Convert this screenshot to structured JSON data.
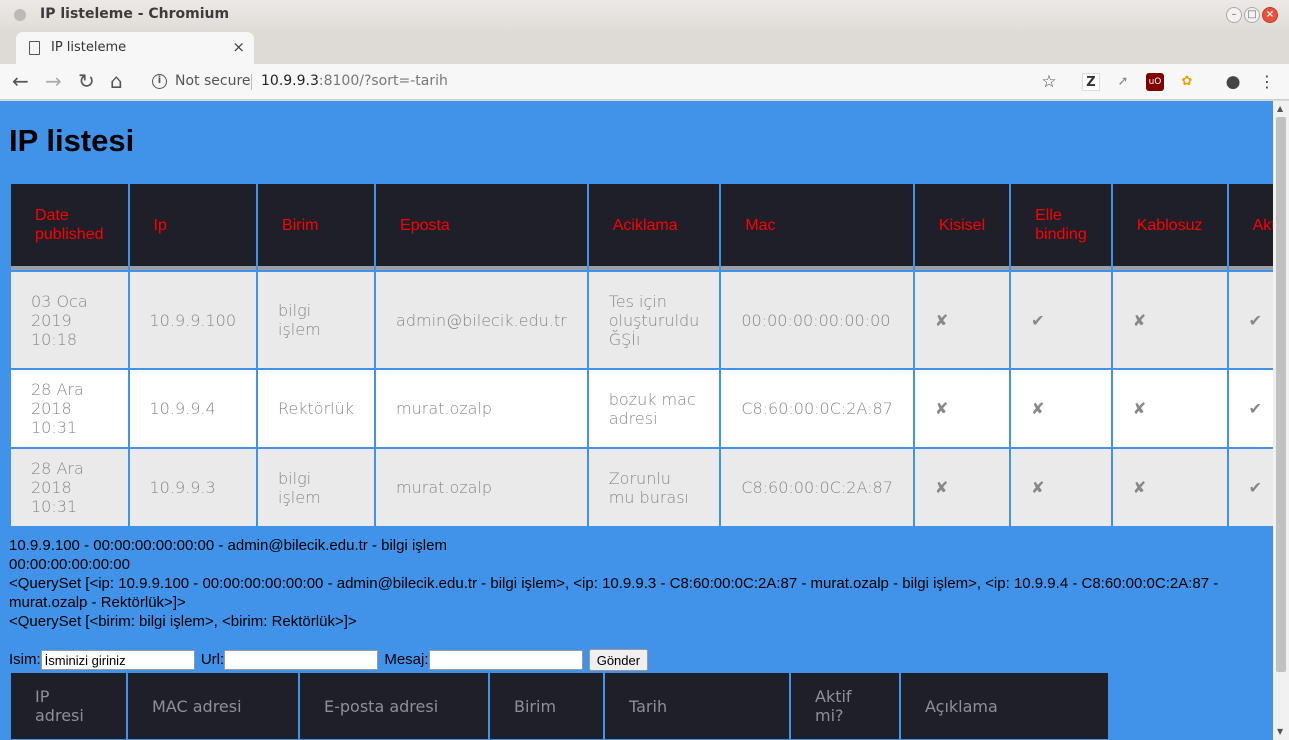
{
  "window": {
    "title": "IP listeleme - Chromium"
  },
  "tab": {
    "title": "IP listeleme",
    "close": "×",
    "new_tab": "+"
  },
  "omnibox": {
    "security": "Not secure",
    "host": "10.9.9.3",
    "path": ":8100/?sort=-tarih"
  },
  "page": {
    "title": "IP listesi",
    "columns": [
      "Date published",
      "Ip",
      "Birim",
      "Eposta",
      "Aciklama",
      "Mac",
      "Kisisel",
      "Elle binding",
      "Kablosuz",
      "Aktif"
    ],
    "rows": [
      {
        "date": "03 Oca 2019 10:18",
        "ip": "10.9.9.100",
        "birim": "bilgi işlem",
        "eposta": "admin@bilecik.edu.tr",
        "aciklama": "Tes için oluşturuldu ĞŞİı",
        "mac": "00:00:00:00:00:00",
        "kisisel": "✘",
        "elle": "✔",
        "kablosuz": "✘",
        "aktif": "✔"
      },
      {
        "date": "28 Ara 2018 10:31",
        "ip": "10.9.9.4",
        "birim": "Rektörlük",
        "eposta": "murat.ozalp",
        "aciklama": "bozuk mac adresi",
        "mac": "C8:60:00:0C:2A:87",
        "kisisel": "✘",
        "elle": "✘",
        "kablosuz": "✘",
        "aktif": "✔"
      },
      {
        "date": "28 Ara 2018 10:31",
        "ip": "10.9.9.3",
        "birim": "bilgi işlem",
        "eposta": "murat.ozalp",
        "aciklama": "Zorunlu mu burası",
        "mac": "C8:60:00:0C:2A:87",
        "kisisel": "✘",
        "elle": "✘",
        "kablosuz": "✘",
        "aktif": "✔"
      }
    ],
    "debug": {
      "line1": "10.9.9.100 - 00:00:00:00:00:00 - admin@bilecik.edu.tr - bilgi işlem",
      "line2": "00:00:00:00:00:00",
      "line3": "<QuerySet [<ip: 10.9.9.100 - 00:00:00:00:00:00 - admin@bilecik.edu.tr - bilgi işlem>, <ip: 10.9.9.3 - C8:60:00:0C:2A:87 - murat.ozalp - bilgi işlem>, <ip: 10.9.9.4 - C8:60:00:0C:2A:87 - murat.ozalp - Rektörlük>]>",
      "line4": "<QuerySet [<birim: bilgi işlem>, <birim: Rektörlük>]>"
    },
    "form": {
      "isim_label": "Isim:",
      "isim_value": "İsminizi giriniz",
      "url_label": "Url:",
      "url_value": "",
      "mesaj_label": "Mesaj:",
      "mesaj_value": "",
      "submit": "Gönder"
    },
    "bottom_columns": [
      "IP adresi",
      "MAC adresi",
      "E-posta adresi",
      "Birim",
      "Tarih",
      "Aktif mi?",
      "Açıklama"
    ]
  },
  "colors": {
    "page_bg": "#4193ea",
    "header_bg": "#1e1f29",
    "header_text": "#ff0000"
  }
}
